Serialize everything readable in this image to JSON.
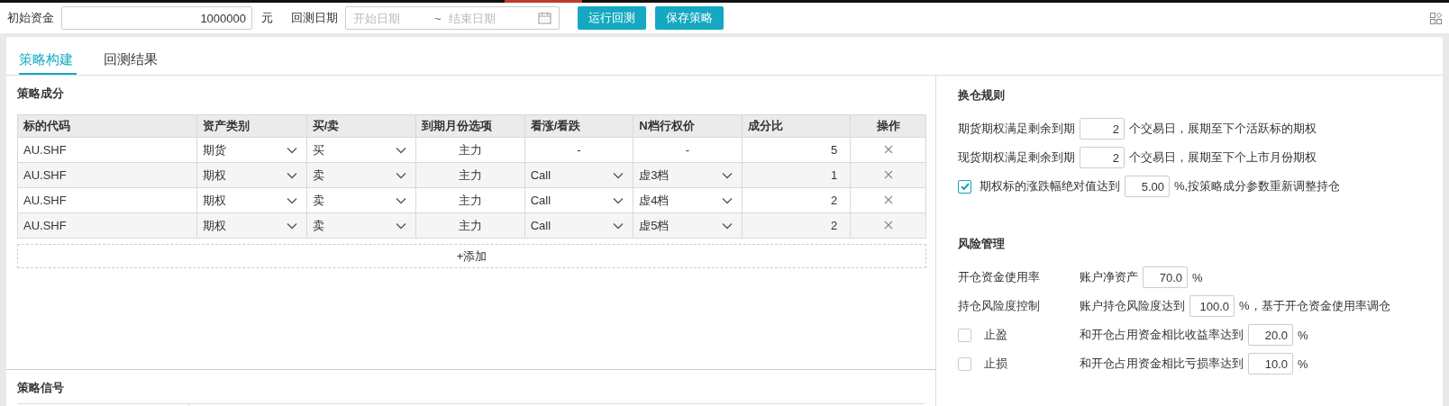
{
  "toolbar": {
    "capital_label": "初始资金",
    "capital_value": "1000000",
    "capital_unit": "元",
    "date_label": "回测日期",
    "start_placeholder": "开始日期",
    "range_separator": "~",
    "end_placeholder": "结束日期",
    "buttons": [
      "运行回测",
      "保存策略"
    ]
  },
  "tabs": [
    {
      "label": "策略构建",
      "selected": true
    },
    {
      "label": "回测结果",
      "selected": false
    }
  ],
  "components": {
    "title": "策略成分",
    "columns": [
      "标的代码",
      "资产类别",
      "买/卖",
      "到期月份选项",
      "看涨/看跌",
      "N档行权价",
      "成分比",
      "操作"
    ],
    "rows": [
      {
        "code": "AU.SHF",
        "asset_type": "期货",
        "side": "买",
        "expiry": "主力",
        "direction": {
          "kind": "text",
          "value": "-"
        },
        "strike": {
          "kind": "text",
          "value": "-"
        },
        "ratio": "5"
      },
      {
        "code": "AU.SHF",
        "asset_type": "期权",
        "side": "卖",
        "expiry": "主力",
        "direction": {
          "kind": "select",
          "value": "Call"
        },
        "strike": {
          "kind": "select",
          "value": "虚3档"
        },
        "ratio": "1"
      },
      {
        "code": "AU.SHF",
        "asset_type": "期权",
        "side": "卖",
        "expiry": "主力",
        "direction": {
          "kind": "select",
          "value": "Call"
        },
        "strike": {
          "kind": "select",
          "value": "虚4档"
        },
        "ratio": "2"
      },
      {
        "code": "AU.SHF",
        "asset_type": "期权",
        "side": "卖",
        "expiry": "主力",
        "direction": {
          "kind": "select",
          "value": "Call"
        },
        "strike": {
          "kind": "select",
          "value": "虚5档"
        },
        "ratio": "2"
      }
    ],
    "add_button": "+添加"
  },
  "signals": {
    "title": "策略信号"
  },
  "rollover": {
    "title": "换仓规则",
    "rules": [
      {
        "kind": "plain",
        "prefix": "期货期权满足剩余到期",
        "value": "2",
        "suffix": "个交易日，展期至下个活跃标的期权"
      },
      {
        "kind": "plain",
        "prefix": "现货期权满足剩余到期",
        "value": "2",
        "suffix": "个交易日，展期至下个上市月份期权"
      },
      {
        "kind": "checkbox",
        "checked": true,
        "prefix": "期权标的涨跌幅绝对值达到",
        "value": "5.00",
        "suffix": "%,按策略成分参数重新调整持仓"
      }
    ]
  },
  "risk": {
    "title": "风险管理",
    "rules": [
      {
        "kind": "plain",
        "label": "开仓资金使用率",
        "prefix": "账户净资产",
        "value": "70.0",
        "suffix": "%"
      },
      {
        "kind": "plain",
        "label": "持仓风险度控制",
        "prefix": "账户持仓风险度达到",
        "value": "100.0",
        "suffix": "%，基于开仓资金使用率调仓"
      },
      {
        "kind": "checkbox",
        "checked": false,
        "label": "止盈",
        "prefix": "和开仓占用资金相比收益率达到",
        "value": "20.0",
        "suffix": "%"
      },
      {
        "kind": "checkbox",
        "checked": false,
        "label": "止损",
        "prefix": "和开仓占用资金相比亏损率达到",
        "value": "10.0",
        "suffix": "%"
      }
    ]
  }
}
